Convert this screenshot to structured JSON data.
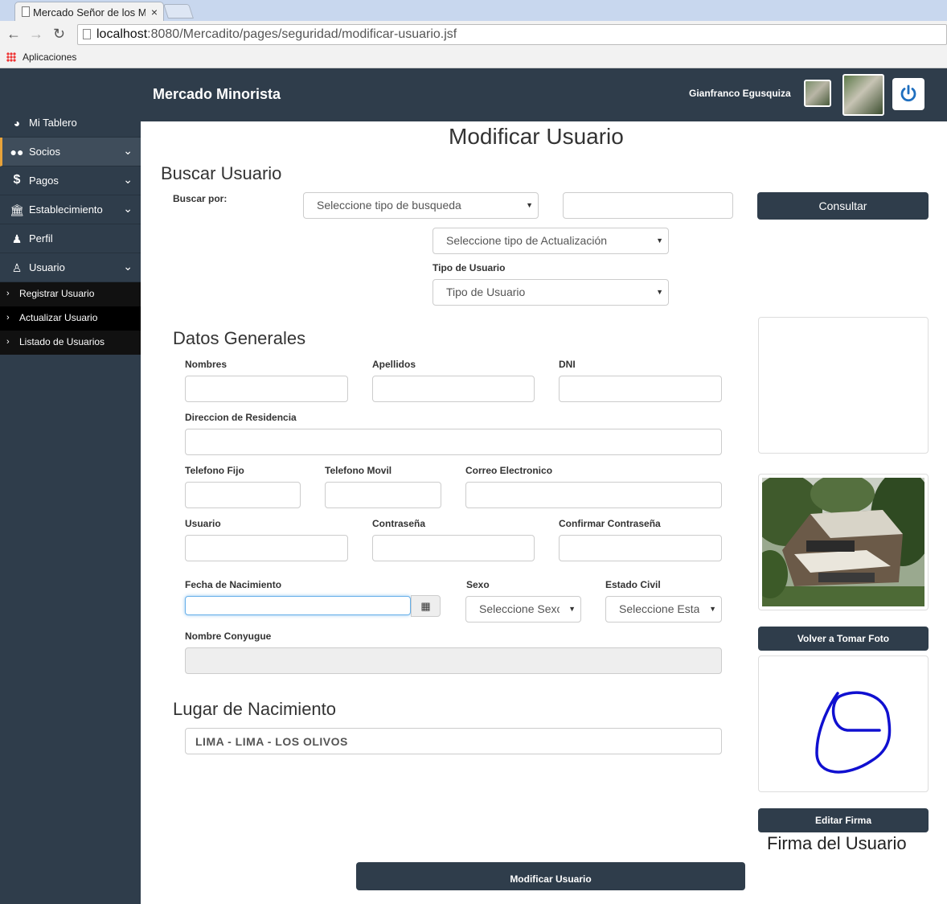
{
  "browser": {
    "tab_title": "Mercado Señor de los Mil",
    "tab_close": "×",
    "url_host": "localhost",
    "url_rest": ":8080/Mercadito/pages/seguridad/modificar-usuario.jsf",
    "bookmarks_label": "Aplicaciones"
  },
  "header": {
    "brand": "Mercado Minorista",
    "user_name": "Gianfranco  Egusquiza"
  },
  "sidebar": {
    "items": [
      {
        "label": "Mi Tablero",
        "icon": "dashboard-icon"
      },
      {
        "label": "Socios",
        "icon": "users-icon"
      },
      {
        "label": "Pagos",
        "icon": "dollar-icon"
      },
      {
        "label": "Establecimiento",
        "icon": "bank-icon"
      },
      {
        "label": "Perfil",
        "icon": "user-secret-icon"
      },
      {
        "label": "Usuario",
        "icon": "user-icon"
      }
    ],
    "subitems": [
      {
        "label": "Registrar Usuario"
      },
      {
        "label": "Actualizar Usuario"
      },
      {
        "label": "Listado de Usuarios"
      }
    ]
  },
  "main": {
    "title": "Modificar Usuario",
    "search": {
      "section": "Buscar Usuario",
      "search_by_label": "Buscar por:",
      "search_type": "Seleccione tipo de busqueda",
      "search_value": "",
      "consult_button": "Consultar",
      "update_type": "Seleccione tipo de Actualización",
      "user_type_label": "Tipo de Usuario",
      "user_type": "Tipo de Usuario"
    },
    "general": {
      "section": "Datos Generales",
      "nombres_label": "Nombres",
      "apellidos_label": "Apellidos",
      "dni_label": "DNI",
      "direccion_label": "Direccion de Residencia",
      "telefono_fijo_label": "Telefono Fijo",
      "telefono_movil_label": "Telefono Movil",
      "correo_label": "Correo Electronico",
      "usuario_label": "Usuario",
      "contrasena_label": "Contraseña",
      "confirmar_label": "Confirmar Contraseña",
      "fecha_label": "Fecha de Nacimiento",
      "sexo_label": "Sexo",
      "sexo_value": "Seleccione Sexo",
      "estado_label": "Estado Civil",
      "estado_value": "Seleccione Estado",
      "conyugue_label": "Nombre Conyugue"
    },
    "birthplace": {
      "section": "Lugar de Nacimiento",
      "value": "LIMA - LIMA - LOS OLIVOS"
    },
    "submit_button": "Modificar Usuario"
  },
  "right": {
    "retake_photo_button": "Volver a Tomar Foto",
    "edit_signature_button": "Editar Firma",
    "signature_caption": "Firma del Usuario"
  }
}
